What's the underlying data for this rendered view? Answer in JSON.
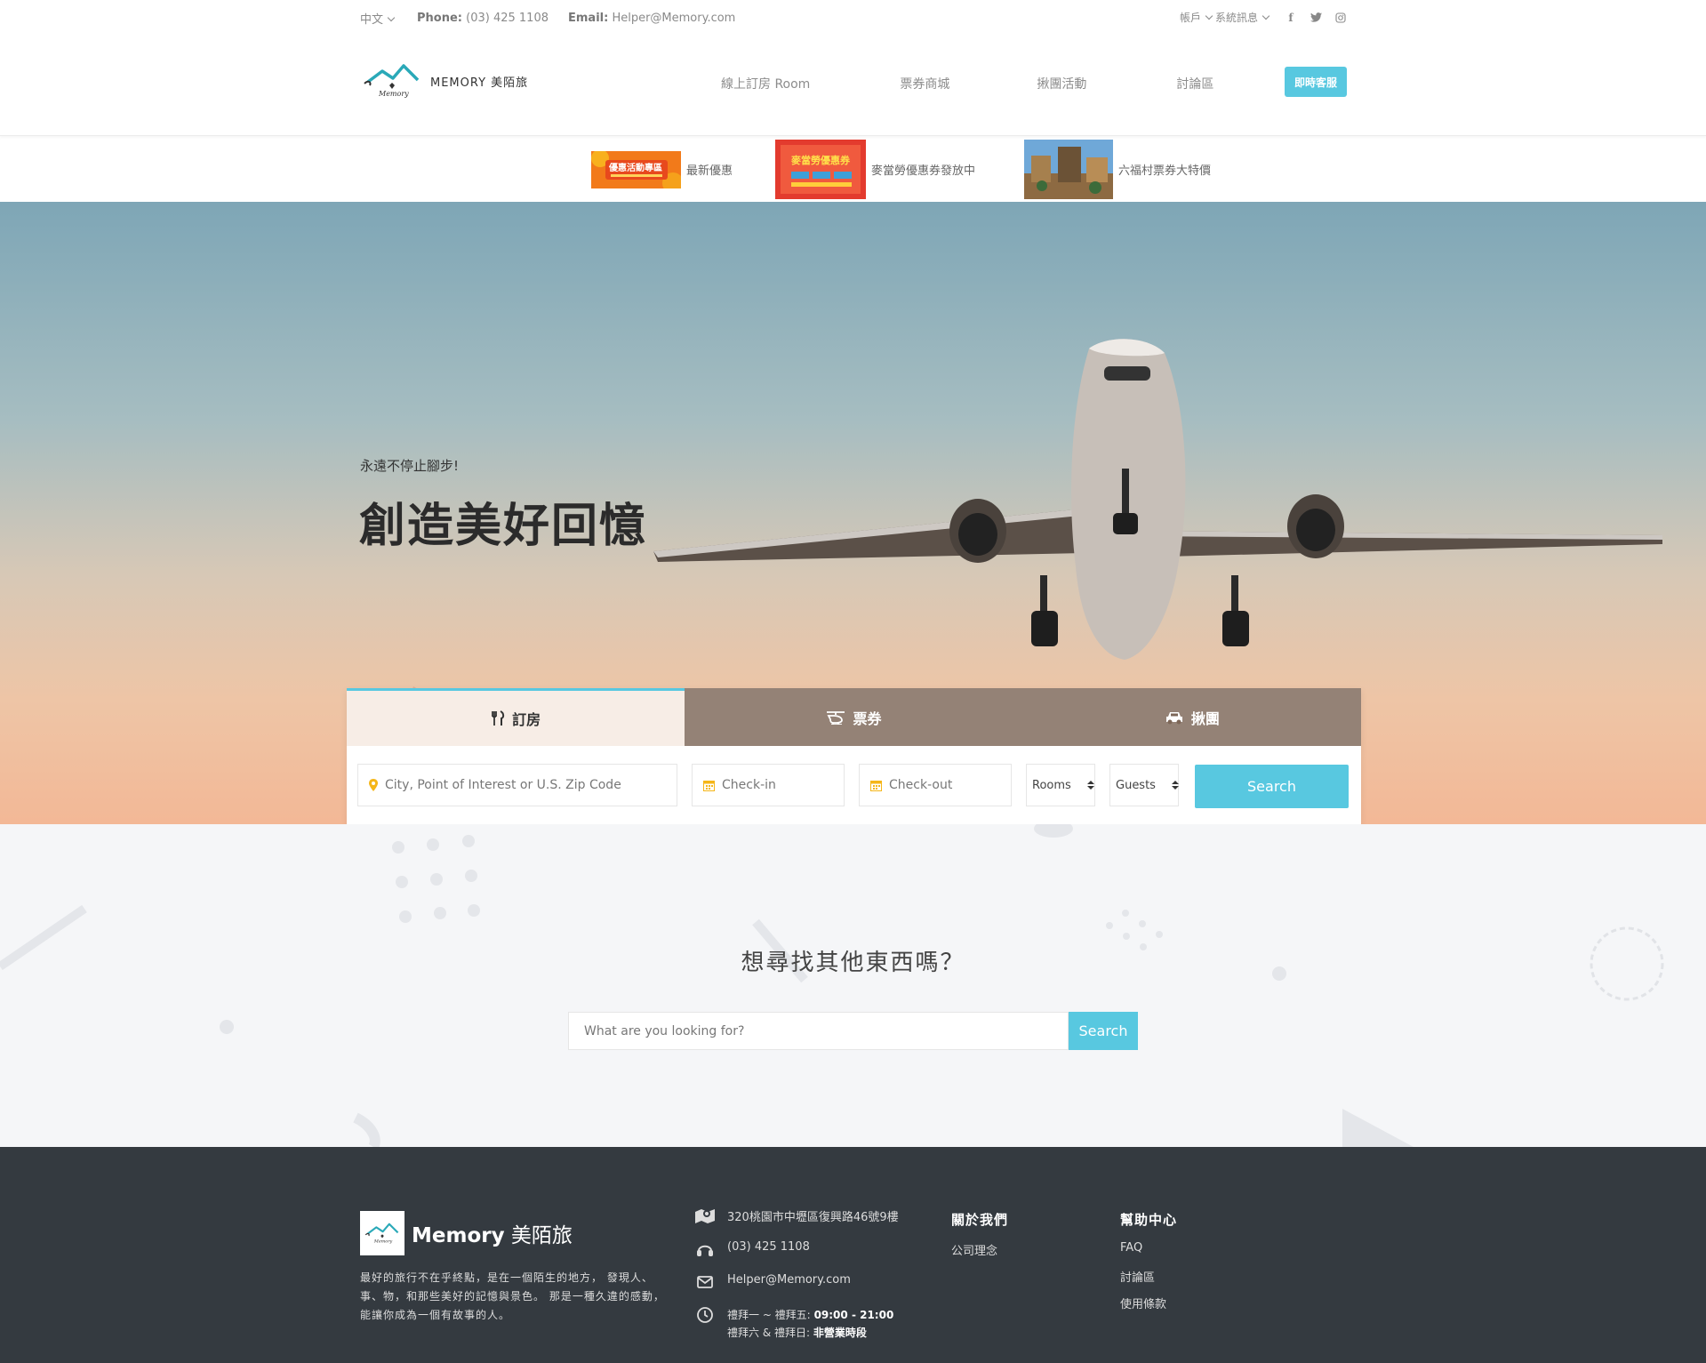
{
  "topbar": {
    "language": "中文",
    "phone_label": "Phone:",
    "phone": "(03) 425 1108",
    "email_label": "Email:",
    "email": "Helper@Memory.com",
    "account": "帳戶",
    "system": "系統訊息"
  },
  "nav": {
    "logo_text": "MEMORY 美陌旅",
    "items": [
      "線上訂房 Room",
      "票券商城",
      "揪團活動",
      "討論區"
    ],
    "cta": "即時客服"
  },
  "promo": [
    {
      "label": "最新優惠",
      "thumb_text": "優惠活動專區"
    },
    {
      "label": "麥當勞優惠券發放中",
      "thumb_text": "麥當勞優惠券"
    },
    {
      "label": "六福村票券大特價",
      "thumb_text": ""
    }
  ],
  "hero": {
    "eyebrow": "永遠不停止腳步!",
    "title": "創造美好回憶"
  },
  "booking": {
    "tabs": [
      "訂房",
      "票券",
      "揪團"
    ],
    "location_placeholder": "City, Point of Interest or U.S. Zip Code",
    "checkin_placeholder": "Check-in",
    "checkout_placeholder": "Check-out",
    "rooms": "Rooms",
    "guests": "Guests",
    "search": "Search"
  },
  "search_section": {
    "title": "想尋找其他東西嗎？",
    "placeholder": "What are you looking for?",
    "button": "Search"
  },
  "footer": {
    "brand_en": "Memory",
    "brand_zh": "美陌旅",
    "description": "最好的旅行不在乎終點，是在一個陌生的地方， 發現人、事、物，和那些美好的記憶與景色。 那是一種久違的感動，能讓你成為一個有故事的人。",
    "address": "320桃園市中壢區復興路46號9樓",
    "phone": "(03) 425 1108",
    "email": "Helper@Memory.com",
    "hours_weekday": "禮拜一 ~ 禮拜五:",
    "hours_weekday_time": "09:00 - 21:00",
    "hours_weekend": "禮拜六 & 禮拜日:",
    "hours_weekend_time": "非營業時段",
    "about_title": "關於我們",
    "about_items": [
      "公司理念"
    ],
    "help_title": "幫助中心",
    "help_items": [
      "FAQ",
      "討論區",
      "使用條款"
    ]
  },
  "colors": {
    "accent": "#58c8e0",
    "footer_bg": "#343a40",
    "tab_inactive": "#7d6758"
  }
}
